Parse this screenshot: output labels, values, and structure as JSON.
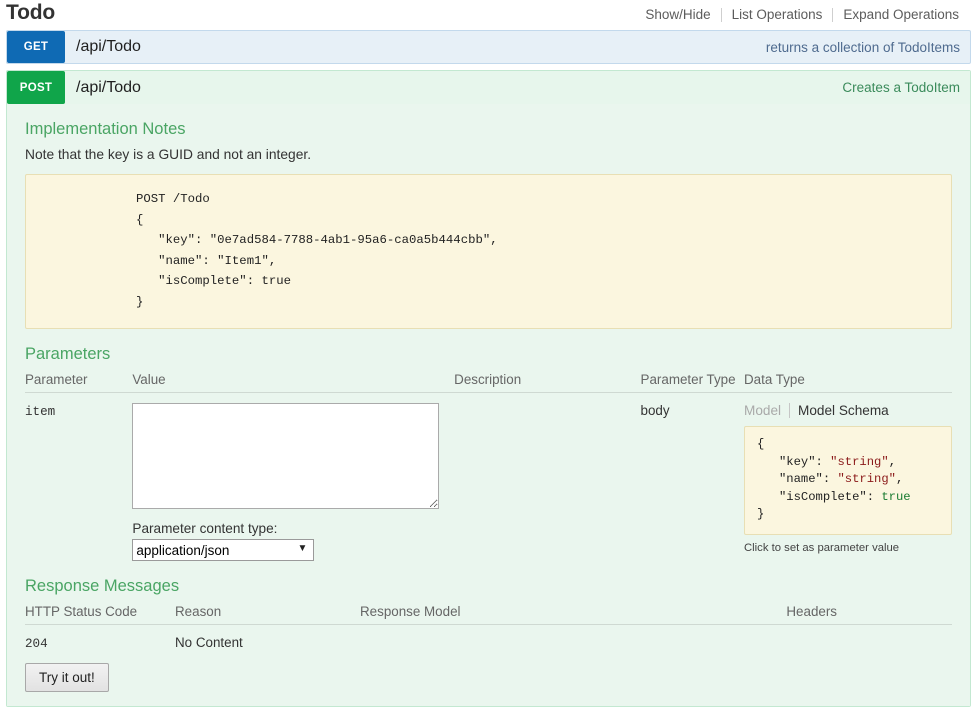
{
  "resource": {
    "title": "Todo",
    "options": [
      {
        "label": "Show/Hide"
      },
      {
        "label": "List Operations"
      },
      {
        "label": "Expand Operations"
      }
    ]
  },
  "operations": [
    {
      "method": "GET",
      "path": "/api/Todo",
      "summary": "returns a collection of TodoItems",
      "method_color": "#0f6ab4"
    },
    {
      "method": "POST",
      "path": "/api/Todo",
      "summary": "Creates a TodoItem",
      "method_color": "#10a54a"
    }
  ],
  "post_details": {
    "notes_heading": "Implementation Notes",
    "notes_text": "Note that the key is a GUID and not an integer.",
    "sample_code": "POST /Todo\n{\n   \"key\": \"0e7ad584-7788-4ab1-95a6-ca0a5b444cbb\",\n   \"name\": \"Item1\",\n   \"isComplete\": true\n}",
    "parameters": {
      "heading": "Parameters",
      "columns": [
        "Parameter",
        "Value",
        "Description",
        "Parameter Type",
        "Data Type"
      ],
      "rows": [
        {
          "name": "item",
          "value": "",
          "value_placeholder": "",
          "description": "",
          "parameter_type": "body",
          "data_type": {
            "tab_model": "Model",
            "tab_model_schema": "Model Schema",
            "schema_lines": [
              {
                "text": "{",
                "type": "plain"
              },
              {
                "key": "\"key\"",
                "value": "\"string\"",
                "value_type": "string",
                "trail": ",",
                "type": "pair"
              },
              {
                "key": "\"name\"",
                "value": "\"string\"",
                "value_type": "string",
                "trail": ",",
                "type": "pair"
              },
              {
                "key": "\"isComplete\"",
                "value": "true",
                "value_type": "bool",
                "trail": "",
                "type": "pair"
              },
              {
                "text": "}",
                "type": "plain"
              }
            ],
            "hint": "Click to set as parameter value"
          }
        }
      ],
      "content_type_label": "Parameter content type:",
      "content_type_selected": "application/json",
      "content_type_options": [
        "application/json"
      ]
    },
    "response_messages": {
      "heading": "Response Messages",
      "columns": [
        "HTTP Status Code",
        "Reason",
        "Response Model",
        "Headers"
      ],
      "rows": [
        {
          "status": "204",
          "reason": "No Content",
          "model": "",
          "headers": ""
        }
      ]
    },
    "try_button": "Try it out!"
  },
  "colors": {
    "get_blue": "#0f6ab4",
    "post_green": "#10a54a",
    "section_green": "#4aa564",
    "panel_bg": "#eaf6ee",
    "code_bg": "#fbf6df"
  }
}
